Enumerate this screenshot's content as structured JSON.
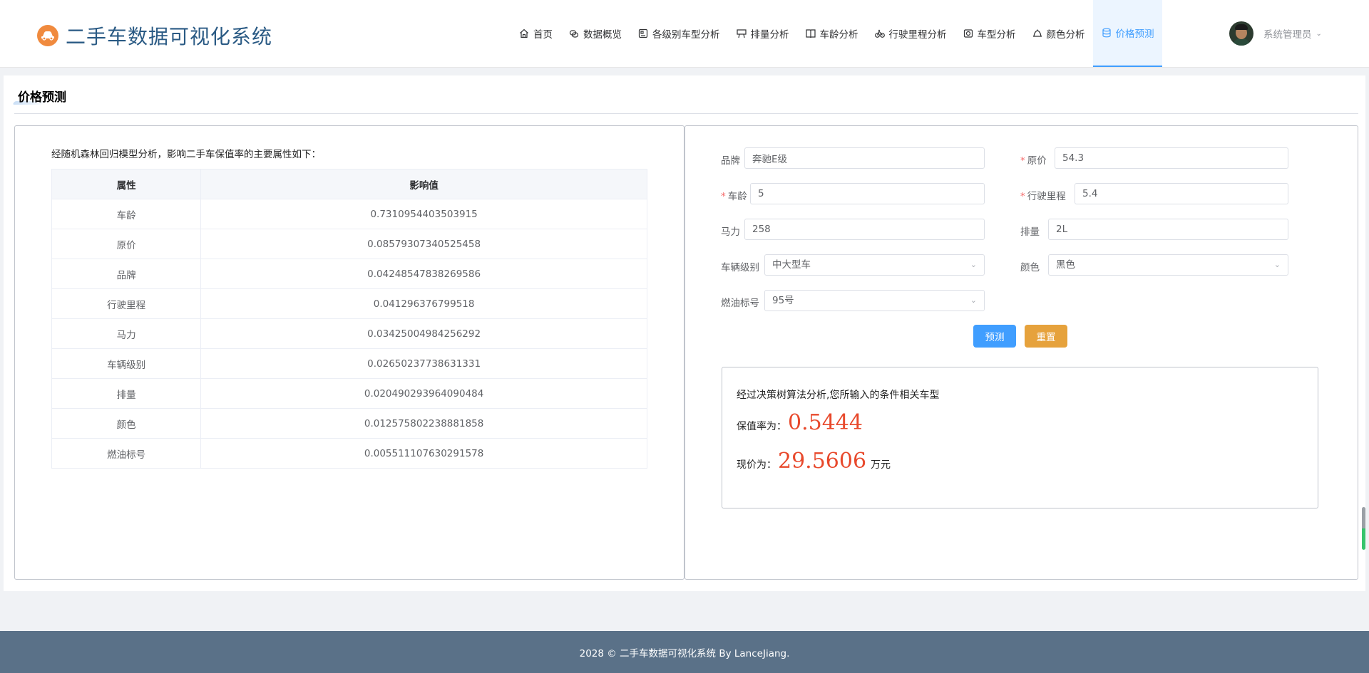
{
  "header": {
    "title": "二手车数据可视化系统",
    "nav": [
      {
        "label": "首页",
        "icon": "home-icon"
      },
      {
        "label": "数据概览",
        "icon": "overview-icon"
      },
      {
        "label": "各级别车型分析",
        "icon": "car-level-icon"
      },
      {
        "label": "排量分析",
        "icon": "displacement-icon"
      },
      {
        "label": "车龄分析",
        "icon": "book-icon"
      },
      {
        "label": "行驶里程分析",
        "icon": "bicycle-icon"
      },
      {
        "label": "车型分析",
        "icon": "camera-icon"
      },
      {
        "label": "颜色分析",
        "icon": "bell-icon"
      },
      {
        "label": "价格预测",
        "icon": "database-icon"
      }
    ],
    "active_nav": "价格预测",
    "user": {
      "name": "系统管理员"
    }
  },
  "page": {
    "title": "价格预测"
  },
  "importance": {
    "intro": "经随机森林回归模型分析，影响二手车保值率的主要属性如下：",
    "columns": [
      "属性",
      "影响值"
    ],
    "rows": [
      [
        "车龄",
        "0.7310954403503915"
      ],
      [
        "原价",
        "0.08579307340525458"
      ],
      [
        "品牌",
        "0.04248547838269586"
      ],
      [
        "行驶里程",
        "0.041296376799518"
      ],
      [
        "马力",
        "0.03425004984256292"
      ],
      [
        "车辆级别",
        "0.02650237738631331"
      ],
      [
        "排量",
        "0.020490293964090484"
      ],
      [
        "颜色",
        "0.012575802238881858"
      ],
      [
        "燃油标号",
        "0.005511107630291578"
      ]
    ]
  },
  "form": {
    "brand": {
      "label": "品牌",
      "value": "奔驰E级"
    },
    "original_price": {
      "label": "原价",
      "value": "54.3"
    },
    "age": {
      "label": "车龄",
      "value": "5"
    },
    "mileage": {
      "label": "行驶里程",
      "value": "5.4"
    },
    "horsepower": {
      "label": "马力",
      "value": "258"
    },
    "displacement": {
      "label": "排量",
      "value": "2L"
    },
    "level": {
      "label": "车辆级别",
      "value": "中大型车"
    },
    "color": {
      "label": "颜色",
      "value": "黑色"
    },
    "fuel": {
      "label": "燃油标号",
      "value": "95号"
    },
    "predict_label": "预测",
    "reset_label": "重置"
  },
  "result": {
    "line1": "经过决策树算法分析,您所输入的条件相关车型",
    "rate_label": "保值率为：",
    "rate_value": "0.5444",
    "price_label": "现价为：",
    "price_value": "29.5606",
    "price_unit": "万元"
  },
  "footer": {
    "text": "2028 © 二手车数据可视化系统 By LanceJiang."
  }
}
